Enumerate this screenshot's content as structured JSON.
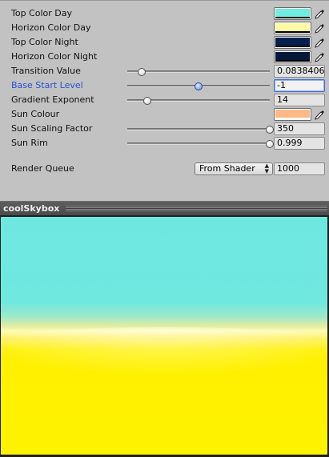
{
  "inspector": {
    "colors": [
      {
        "label": "Top Color Day",
        "value": "#70ece0"
      },
      {
        "label": "Horizon Color Day",
        "value": "#fdfaa6"
      },
      {
        "label": "Top Color Night",
        "value": "#06204e"
      },
      {
        "label": "Horizon Color Night",
        "value": "#05183a"
      }
    ],
    "sliders": [
      {
        "label": "Transition Value",
        "value_text": "0.0838406",
        "position": 0.1
      },
      {
        "label": "Base Start Level",
        "value_text": "-1",
        "position": 0.5
      },
      {
        "label": "Gradient Exponent",
        "value_text": "14",
        "position": 0.14
      }
    ],
    "sun_colour": {
      "label": "Sun Colour",
      "value": "#ffb987"
    },
    "sun_sliders": [
      {
        "label": "Sun Scaling Factor",
        "value_text": "350",
        "position": 1.0
      },
      {
        "label": "Sun Rim",
        "value_text": "0.999",
        "position": 1.0
      }
    ],
    "render_queue": {
      "label": "Render Queue",
      "dropdown": "From Shader",
      "value": "1000"
    }
  },
  "preview": {
    "title": "coolSkybox",
    "sky_top_color": "#6de8e0",
    "sky_bottom_color": "#fff200"
  },
  "icons": {
    "color_picker": "eyedropper-icon",
    "dropdown_arrows": "up-down-arrows-icon"
  },
  "colors": {
    "accent": "#2a4fd6",
    "panel_bg": "#c2c2c2"
  }
}
